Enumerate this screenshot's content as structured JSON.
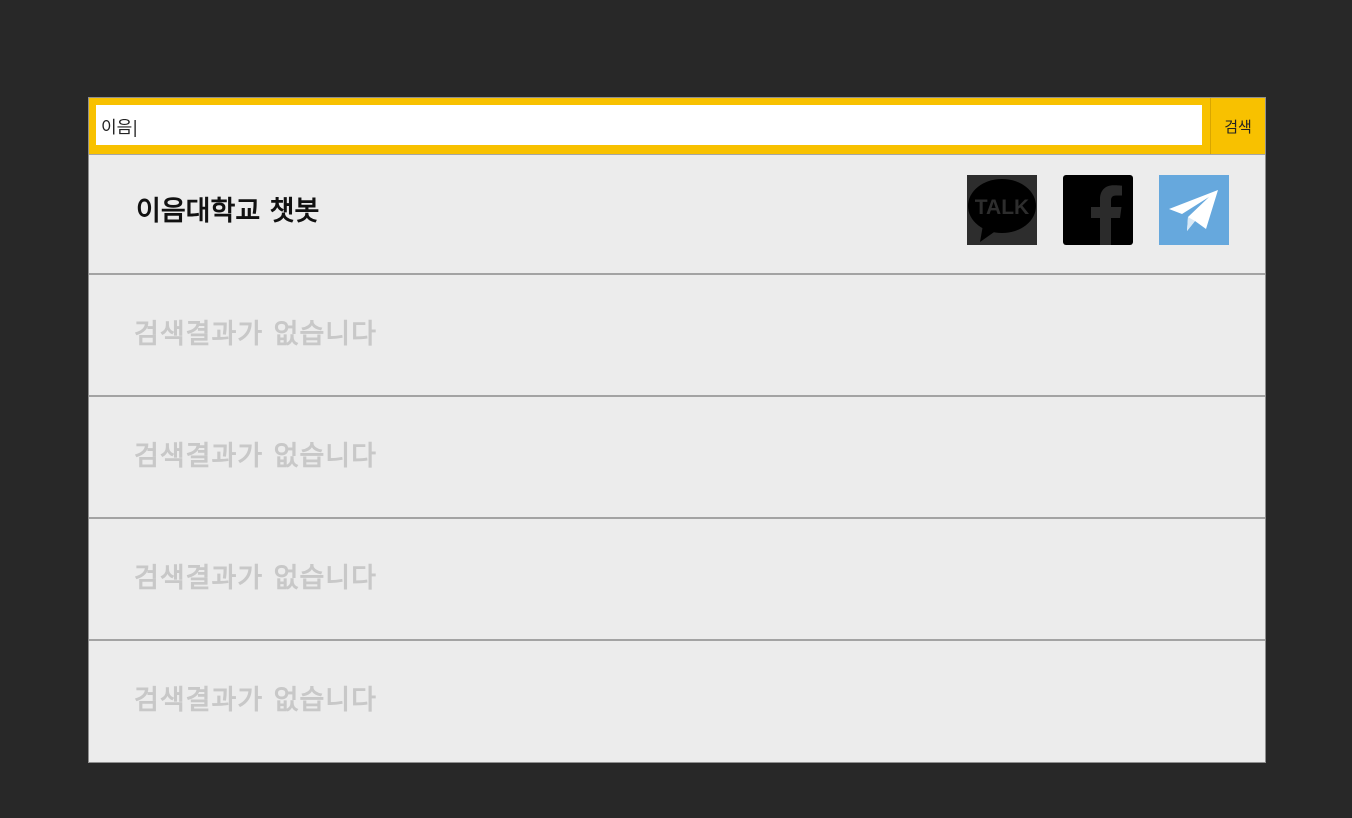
{
  "search": {
    "value": "이음|",
    "button_label": "검색"
  },
  "results": {
    "first": {
      "title": "이음대학교 챗봇",
      "icons": [
        "kakaotalk-icon",
        "facebook-icon",
        "telegram-icon"
      ],
      "talk_text": "TALK",
      "telegram_color": "#66a8dd"
    },
    "empty_label": "검색결과가 없습니다",
    "empty_rows": [
      "검색결과가 없습니다",
      "검색결과가 없습니다",
      "검색결과가 없습니다",
      "검색결과가 없습니다"
    ]
  },
  "colors": {
    "accent": "#f8c100",
    "background": "#282828",
    "panel": "#ececec",
    "empty_text": "#c8c8c8"
  }
}
